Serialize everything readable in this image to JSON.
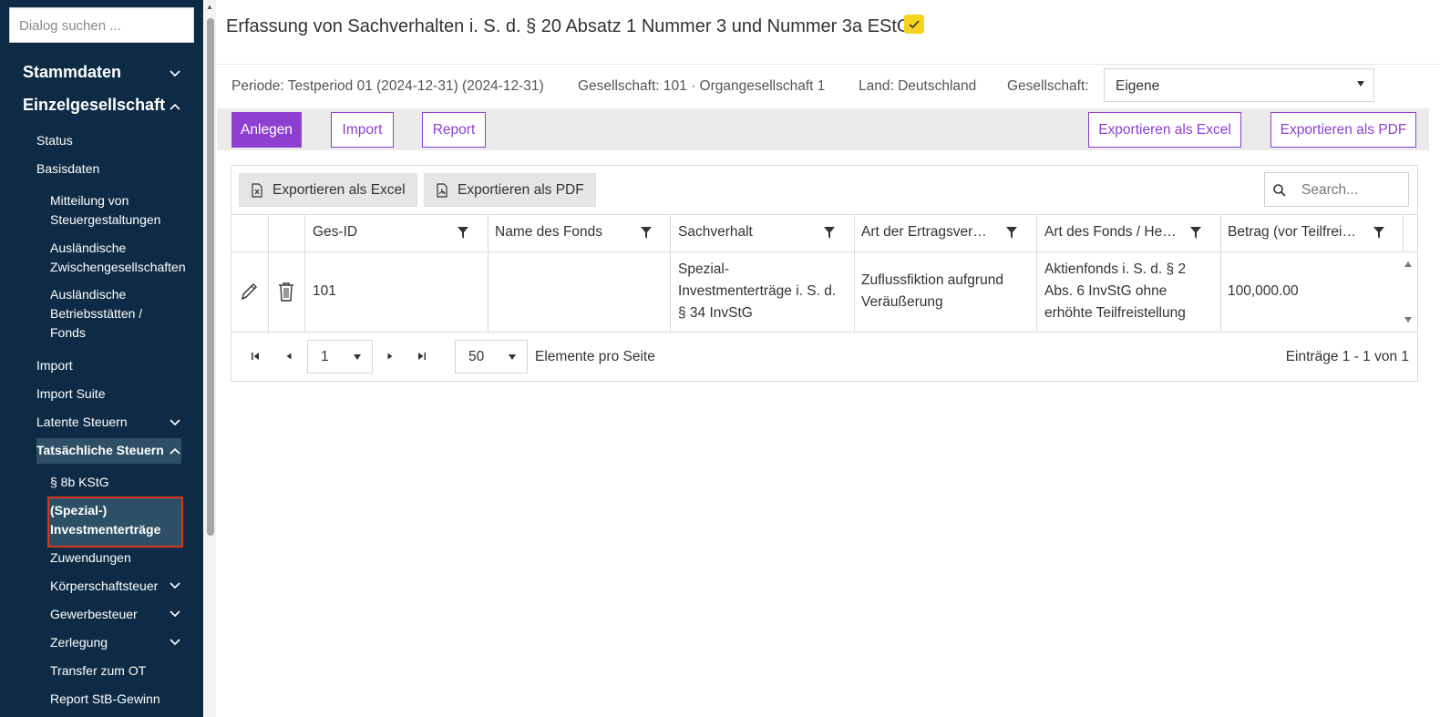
{
  "sidebar": {
    "search_placeholder": "Dialog suchen ...",
    "stammdaten": "Stammdaten",
    "einzelgesellschaft": "Einzelgesellschaft",
    "status": "Status",
    "basisdaten": "Basisdaten",
    "mitteilung": [
      "Mitteilung von",
      "Steuergestaltungen"
    ],
    "zwischen": [
      "Ausländische",
      "Zwischengesellschaften"
    ],
    "betrieb": [
      "Ausländische",
      "Betriebsstätten /",
      "Fonds"
    ],
    "import": "Import",
    "import_suite": "Import Suite",
    "latente": "Latente Steuern",
    "tatsaechliche": "Tatsächliche Steuern",
    "kstg": "§ 8b KStG",
    "spezial": [
      "(Spezial-)",
      "Investmenterträge"
    ],
    "zuwendungen": "Zuwendungen",
    "koerperschaft": "Körperschaftsteuer",
    "gewerbe": "Gewerbesteuer",
    "zerlegung": "Zerlegung",
    "transfer": "Transfer zum OT",
    "report_stb": "Report StB-Gewinn"
  },
  "header": {
    "title": "Erfassung von Sachverhalten i. S. d. § 20 Absatz 1 Nummer 3 und Nummer 3a EStG"
  },
  "meta": {
    "periode": "Periode: Testperiod 01 (2024-12-31) (2024-12-31)",
    "gesellschaft_info": "Gesellschaft: 101 · Organgesellschaft 1",
    "land": "Land: Deutschland",
    "gesellschaft_label": "Gesellschaft:",
    "gesellschaft_value": "Eigene"
  },
  "toolbar": {
    "anlegen": "Anlegen",
    "import": "Import",
    "report": "Report",
    "export_excel": "Exportieren als Excel",
    "export_pdf": "Exportieren als PDF"
  },
  "grid": {
    "export_excel": "Exportieren als Excel",
    "export_pdf": "Exportieren als PDF",
    "search_placeholder": "Search...",
    "columns": [
      "Ges-ID",
      "Name des Fonds",
      "Sachverhalt",
      "Art der Ertragsver…",
      "Art des Fonds / He…",
      "Betrag (vor Teilfrei…"
    ],
    "rows": [
      {
        "ges_id": "101",
        "name": "",
        "sachverhalt": [
          "Spezial-",
          "Investmenterträge i. S. d.",
          "§ 34 InvStG"
        ],
        "art_ertrag": [
          "Zuflussfiktion aufgrund",
          "Veräußerung"
        ],
        "art_fonds": [
          "Aktienfonds i. S. d. § 2",
          "Abs. 6 InvStG ohne",
          "erhöhte Teilfreistellung"
        ],
        "betrag": "100,000.00"
      }
    ]
  },
  "pager": {
    "page": "1",
    "page_size": "50",
    "per_page_label": "Elemente pro Seite",
    "info": "Einträge 1 - 1 von 1"
  }
}
